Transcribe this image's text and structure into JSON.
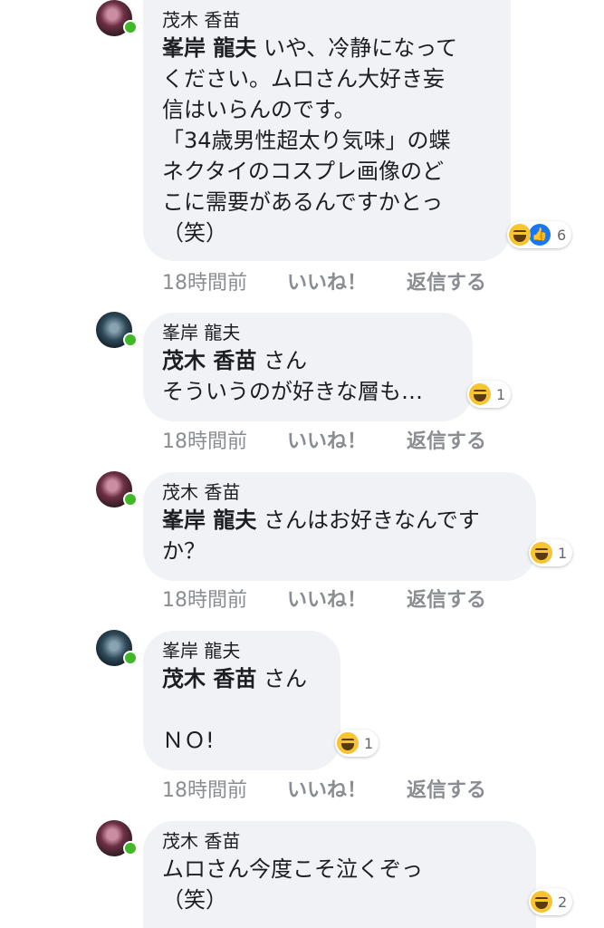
{
  "comments": [
    {
      "author": "茂木 香苗",
      "mention": "峯岸 龍夫",
      "text_lines": [
        " いや、冷静になって",
        "ください。ムロさん大好き妄",
        "信はいらんのです。",
        "「34歳男性超太り気味」の蝶",
        "ネクタイのコスプレ画像のど",
        "こに需要があるんですかとっ",
        "（笑）"
      ],
      "reactions": [
        "haha",
        "like"
      ],
      "reaction_count": "6",
      "time": "18時間前",
      "like_label": "いいね！",
      "reply_label": "返信する"
    },
    {
      "author": "峯岸 龍夫",
      "mention": "茂木 香苗",
      "text_lines": [
        " さん",
        "そういうのが好きな層も…"
      ],
      "reactions": [
        "haha"
      ],
      "reaction_count": "1",
      "time": "18時間前",
      "like_label": "いいね！",
      "reply_label": "返信する"
    },
    {
      "author": "茂木 香苗",
      "mention": "峯岸 龍夫",
      "text_lines": [
        " さんはお好きなんです",
        "か？"
      ],
      "reactions": [
        "haha"
      ],
      "reaction_count": "1",
      "time": "18時間前",
      "like_label": "いいね！",
      "reply_label": "返信する"
    },
    {
      "author": "峯岸 龍夫",
      "mention": "茂木 香苗",
      "text_lines": [
        " さん",
        "",
        "ＮＯ!"
      ],
      "reactions": [
        "haha"
      ],
      "reaction_count": "1",
      "time": "18時間前",
      "like_label": "いいね！",
      "reply_label": "返信する"
    },
    {
      "author": "茂木 香苗",
      "mention": "",
      "text_lines": [
        "ムロさん今度こそ泣くぞっ",
        "（笑）"
      ],
      "reactions": [
        "haha"
      ],
      "reaction_count": "2"
    }
  ],
  "colors": {
    "bubble": "#f0f2f5",
    "online": "#42b72a",
    "meta": "#8a8d91",
    "like_blue": "#1877f2",
    "haha_yellow": "#f7c531"
  }
}
